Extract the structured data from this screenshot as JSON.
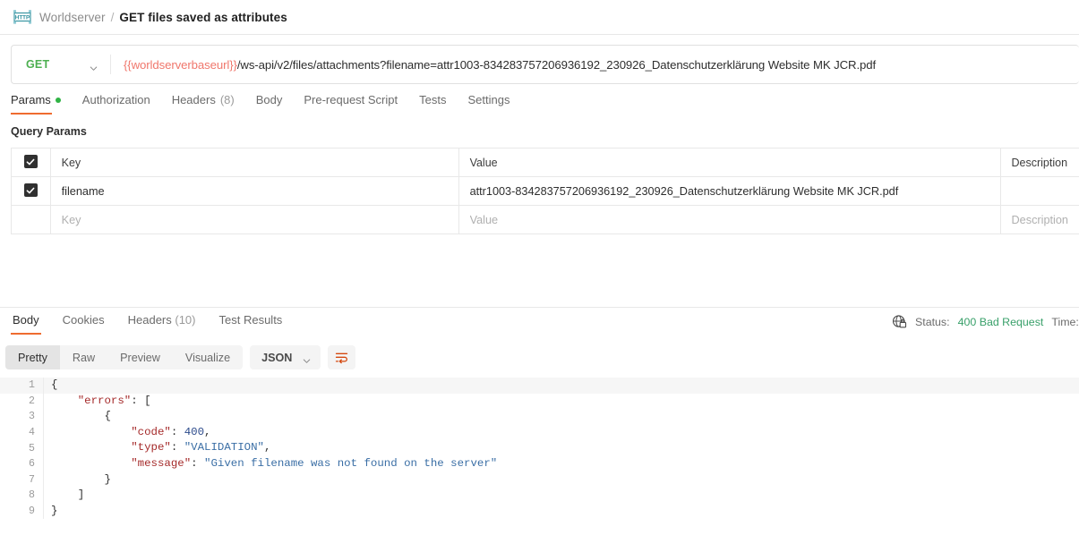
{
  "breadcrumb": {
    "icon": "http-protocol-icon",
    "collection": "Worldserver",
    "separator": "/",
    "request_name": "GET files saved as attributes"
  },
  "url_bar": {
    "method": "GET",
    "method_color": "#4caf50",
    "chevron_icon": "chevron-down-icon",
    "url_variable": "{{worldserverbaseurl}}",
    "url_variable_color": "#f0776c",
    "url_rest": "/ws-api/v2/files/attachments?filename=attr1003-834283757206936192_230926_Datenschutzerklärung Website MK JCR.pdf"
  },
  "request_tabs": [
    {
      "label": "Params",
      "active": true,
      "has_dot": true
    },
    {
      "label": "Authorization",
      "active": false,
      "has_dot": false
    },
    {
      "label": "Headers",
      "count": "(8)",
      "active": false,
      "has_dot": false
    },
    {
      "label": "Body",
      "active": false,
      "has_dot": false
    },
    {
      "label": "Pre-request Script",
      "active": false,
      "has_dot": false
    },
    {
      "label": "Tests",
      "active": false,
      "has_dot": false
    },
    {
      "label": "Settings",
      "active": false,
      "has_dot": false
    }
  ],
  "query_params": {
    "section_title": "Query Params",
    "headers": {
      "key": "Key",
      "value": "Value",
      "description": "Description"
    },
    "rows": [
      {
        "checked": true,
        "key": "filename",
        "value": "attr1003-834283757206936192_230926_Datenschutzerklärung Website MK JCR.pdf",
        "description": ""
      }
    ],
    "placeholder_row": {
      "key": "Key",
      "value": "Value",
      "description": "Description"
    }
  },
  "response": {
    "tabs": [
      {
        "label": "Body",
        "active": true
      },
      {
        "label": "Cookies",
        "active": false
      },
      {
        "label": "Headers",
        "count": "(10)",
        "active": false
      },
      {
        "label": "Test Results",
        "active": false
      }
    ],
    "status": {
      "icon": "globe-lock-icon",
      "status_label": "Status:",
      "status_value": "400 Bad Request",
      "status_color": "#39a06a",
      "time_label": "Time:"
    },
    "view_modes": [
      {
        "label": "Pretty",
        "active": true
      },
      {
        "label": "Raw",
        "active": false
      },
      {
        "label": "Preview",
        "active": false
      },
      {
        "label": "Visualize",
        "active": false
      }
    ],
    "format": {
      "label": "JSON",
      "chevron_icon": "chevron-down-icon"
    },
    "wrap_button_icon": "word-wrap-icon",
    "body_lines": [
      {
        "n": "1",
        "highlight": true,
        "tokens": [
          {
            "t": "{",
            "c": "tk-pun"
          }
        ]
      },
      {
        "n": "2",
        "highlight": false,
        "tokens": [
          {
            "t": "    ",
            "c": "tk-pun"
          },
          {
            "t": "\"errors\"",
            "c": "tk-key"
          },
          {
            "t": ": [",
            "c": "tk-pun"
          }
        ]
      },
      {
        "n": "3",
        "highlight": false,
        "tokens": [
          {
            "t": "        ",
            "c": "tk-pun"
          },
          {
            "t": "{",
            "c": "tk-pun"
          }
        ]
      },
      {
        "n": "4",
        "highlight": false,
        "tokens": [
          {
            "t": "            ",
            "c": "tk-pun"
          },
          {
            "t": "\"code\"",
            "c": "tk-key"
          },
          {
            "t": ": ",
            "c": "tk-pun"
          },
          {
            "t": "400",
            "c": "tk-num"
          },
          {
            "t": ",",
            "c": "tk-pun"
          }
        ]
      },
      {
        "n": "5",
        "highlight": false,
        "tokens": [
          {
            "t": "            ",
            "c": "tk-pun"
          },
          {
            "t": "\"type\"",
            "c": "tk-key"
          },
          {
            "t": ": ",
            "c": "tk-pun"
          },
          {
            "t": "\"VALIDATION\"",
            "c": "tk-str"
          },
          {
            "t": ",",
            "c": "tk-pun"
          }
        ]
      },
      {
        "n": "6",
        "highlight": false,
        "tokens": [
          {
            "t": "            ",
            "c": "tk-pun"
          },
          {
            "t": "\"message\"",
            "c": "tk-key"
          },
          {
            "t": ": ",
            "c": "tk-pun"
          },
          {
            "t": "\"Given filename was not found on the server\"",
            "c": "tk-str"
          }
        ]
      },
      {
        "n": "7",
        "highlight": false,
        "tokens": [
          {
            "t": "        ",
            "c": "tk-pun"
          },
          {
            "t": "}",
            "c": "tk-pun"
          }
        ]
      },
      {
        "n": "8",
        "highlight": false,
        "tokens": [
          {
            "t": "    ",
            "c": "tk-pun"
          },
          {
            "t": "]",
            "c": "tk-pun"
          }
        ]
      },
      {
        "n": "9",
        "highlight": false,
        "tokens": [
          {
            "t": "}",
            "c": "tk-pun"
          }
        ]
      }
    ]
  }
}
